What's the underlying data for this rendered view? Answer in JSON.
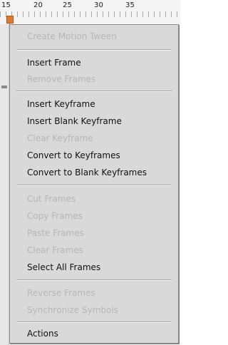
{
  "timeline": {
    "ruler_numbers": [
      "15",
      "20",
      "25",
      "30",
      "35"
    ]
  },
  "menu": {
    "items": [
      {
        "label": "Create Motion Tween",
        "enabled": false
      },
      {
        "label": "Insert Frame",
        "enabled": true
      },
      {
        "label": "Remove Frames",
        "enabled": false
      },
      {
        "label": "Insert Keyframe",
        "enabled": true
      },
      {
        "label": "Insert Blank Keyframe",
        "enabled": true
      },
      {
        "label": "Clear Keyframe",
        "enabled": false
      },
      {
        "label": "Convert to Keyframes",
        "enabled": true
      },
      {
        "label": "Convert to Blank Keyframes",
        "enabled": true
      },
      {
        "label": "Cut Frames",
        "enabled": false
      },
      {
        "label": "Copy Frames",
        "enabled": false
      },
      {
        "label": "Paste Frames",
        "enabled": false
      },
      {
        "label": "Clear Frames",
        "enabled": false
      },
      {
        "label": "Select All Frames",
        "enabled": true
      },
      {
        "label": "Reverse Frames",
        "enabled": false
      },
      {
        "label": "Synchronize Symbols",
        "enabled": false
      },
      {
        "label": "Actions",
        "enabled": true
      }
    ]
  },
  "colors": {
    "menu_background": "#d9d9d9",
    "enabled_text": "#111111",
    "disabled_text": "#b6b6b6",
    "playhead": "#e07a2e"
  }
}
